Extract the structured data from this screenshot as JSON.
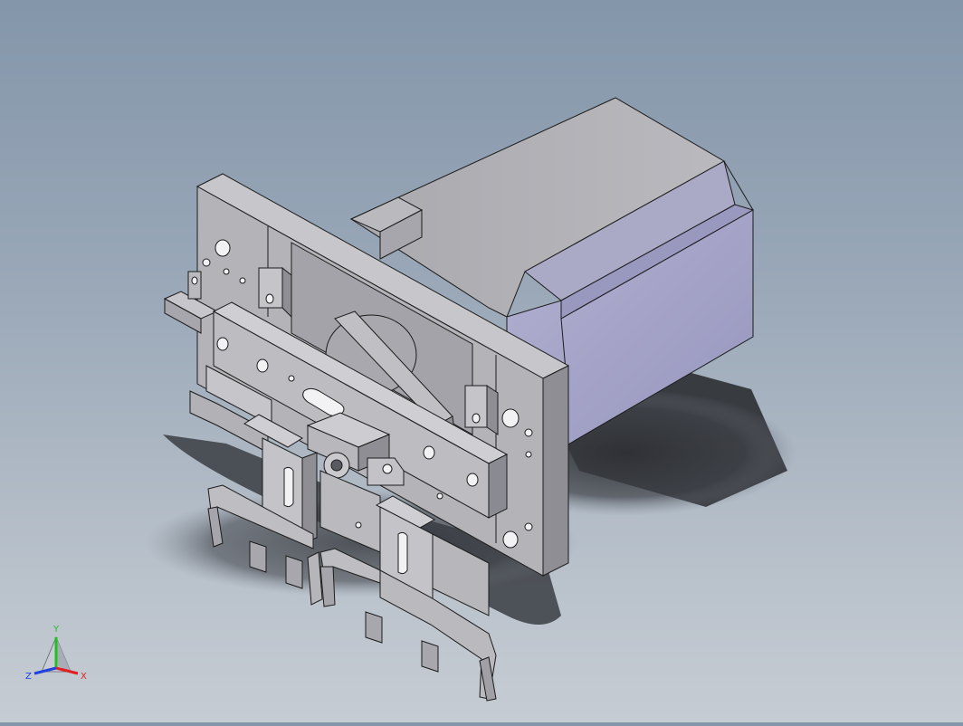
{
  "viewport": {
    "background_top": "#8496aa",
    "background_bottom": "#c6ccd3",
    "shaded_face_colors": {
      "light": "#c9c9ce",
      "mid": "#b0b0b6",
      "dark": "#8a8a92",
      "motor_front": "#a7a6c9",
      "motor_top": "#b8b8bf",
      "shadow": "#3b3d42"
    }
  },
  "triad": {
    "x_label": "X",
    "y_label": "Y",
    "z_label": "Z",
    "x_color": "#e02020",
    "y_color": "#20c020",
    "z_color": "#2040e0"
  }
}
